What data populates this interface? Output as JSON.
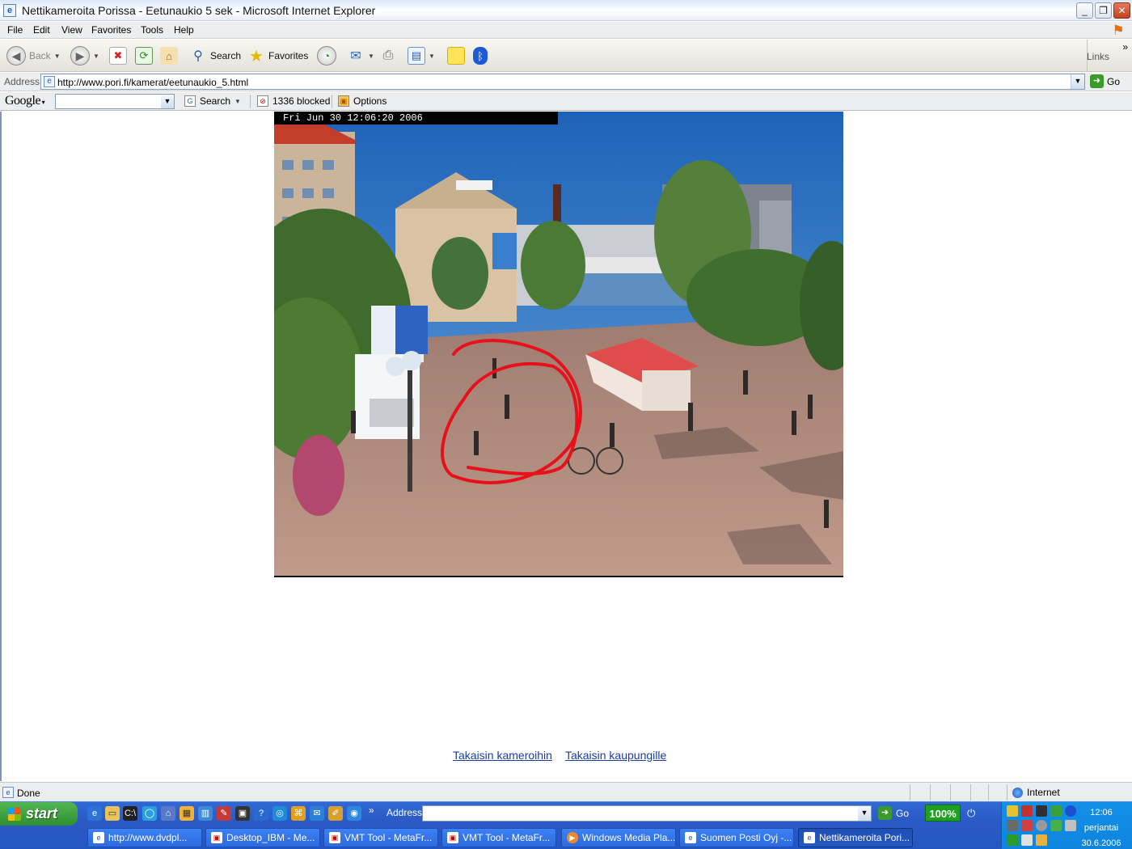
{
  "window": {
    "title": "Nettikameroita Porissa - Eetunaukio 5 sek - Microsoft Internet Explorer"
  },
  "menu": [
    "File",
    "Edit",
    "View",
    "Favorites",
    "Tools",
    "Help"
  ],
  "toolbar": {
    "back": "Back",
    "search": "Search",
    "favorites": "Favorites",
    "links": "Links"
  },
  "address": {
    "label": "Address",
    "url": "http://www.pori.fi/kamerat/eetunaukio_5.html",
    "go": "Go"
  },
  "google": {
    "logo": "Google",
    "search": "Search",
    "blocked": "1336 blocked",
    "options": "Options"
  },
  "page": {
    "camera_timestamp": "Fri Jun 30  12:06:20  2006",
    "links": [
      "Takaisin kameroihin",
      "Takaisin kaupungille"
    ]
  },
  "status": {
    "text": "Done",
    "zone": "Internet"
  },
  "taskbar": {
    "start": "start",
    "address_label": "Address",
    "go": "Go",
    "zoom": "100%",
    "tasks": [
      "http://www.dvdpl...",
      "Desktop_IBM - Me...",
      "VMT Tool - MetaFr...",
      "VMT Tool - MetaFr...",
      "Windows Media Pla...",
      "Suomen Posti Oyj -...",
      "Nettikameroita Pori..."
    ],
    "clock": {
      "time": "12:06",
      "day": "perjantai",
      "date": "30.6.2006"
    }
  },
  "colors": {
    "annotation": "#e8101a",
    "link": "#1a3ea8",
    "taskbar": "#2456c2",
    "sky": "#2e78c8",
    "pavement": "#b08a7c"
  }
}
